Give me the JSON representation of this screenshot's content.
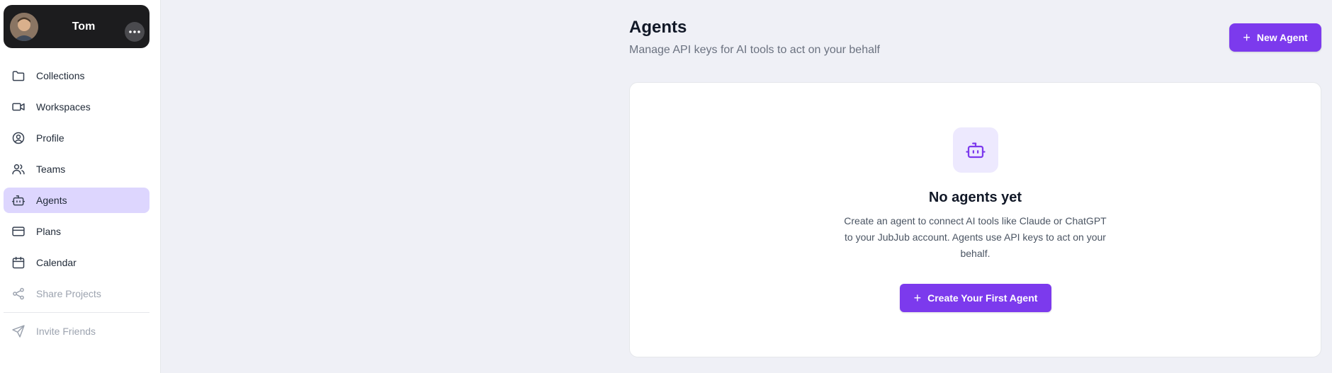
{
  "user": {
    "name": "Tom"
  },
  "sidebar": {
    "items": [
      {
        "label": "Collections",
        "icon": "folder-icon"
      },
      {
        "label": "Workspaces",
        "icon": "video-icon"
      },
      {
        "label": "Profile",
        "icon": "user-circle-icon"
      },
      {
        "label": "Teams",
        "icon": "users-icon"
      },
      {
        "label": "Agents",
        "icon": "robot-icon",
        "active": true
      },
      {
        "label": "Plans",
        "icon": "credit-card-icon"
      },
      {
        "label": "Calendar",
        "icon": "calendar-icon"
      },
      {
        "label": "Share Projects",
        "icon": "share-icon",
        "muted": true
      },
      {
        "label": "Invite Friends",
        "icon": "send-icon",
        "muted": true
      }
    ]
  },
  "header": {
    "title": "Agents",
    "subtitle": "Manage API keys for AI tools to act on your behalf",
    "new_agent_label": "New Agent"
  },
  "empty_state": {
    "title": "No agents yet",
    "description": "Create an agent to connect AI tools like Claude or ChatGPT to your JubJub account. Agents use API keys to act on your behalf.",
    "button_label": "Create Your First Agent"
  },
  "colors": {
    "accent": "#7c3aed",
    "active_nav_bg": "#ddd6fe",
    "page_bg": "#eff0f6"
  }
}
